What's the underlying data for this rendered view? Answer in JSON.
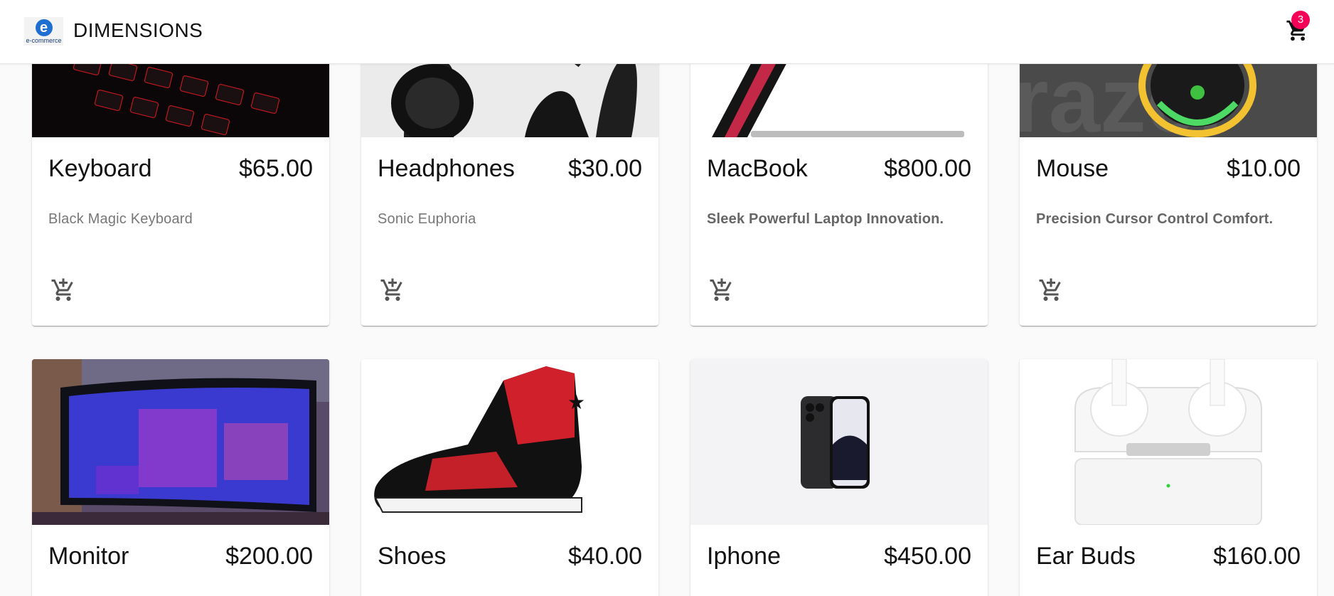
{
  "header": {
    "logo_letter": "e",
    "logo_text": "e-commerce",
    "brand": "DIMENSIONS",
    "cart_count": "3"
  },
  "products": [
    {
      "name": "Keyboard",
      "price": "$65.00",
      "description": "Black Magic Keyboard",
      "image": "keyboard-image"
    },
    {
      "name": "Headphones",
      "price": "$30.00",
      "description": "Sonic Euphoria",
      "image": "headphones-image"
    },
    {
      "name": "MacBook",
      "price": "$800.00",
      "description": "Sleek Powerful Laptop Innovation.",
      "image": "macbook-image"
    },
    {
      "name": "Mouse",
      "price": "$10.00",
      "description": "Precision Cursor Control Comfort.",
      "image": "mouse-image"
    },
    {
      "name": "Monitor",
      "price": "$200.00",
      "image": "monitor-image"
    },
    {
      "name": "Shoes",
      "price": "$40.00",
      "image": "shoes-image"
    },
    {
      "name": "Iphone",
      "price": "$450.00",
      "image": "iphone-image"
    },
    {
      "name": "Ear Buds",
      "price": "$160.00",
      "image": "earbuds-image"
    }
  ],
  "colors": {
    "badge": "#f50057",
    "page_background": "#fafafa"
  }
}
